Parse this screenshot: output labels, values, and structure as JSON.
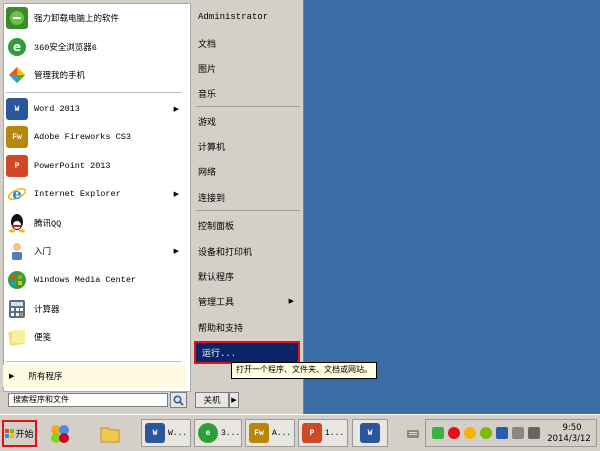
{
  "left_menu": {
    "items": [
      {
        "label": "强力卸载电脑上的软件",
        "icon": "uninstall-icon",
        "color": "#3a8b2c"
      },
      {
        "label": "360安全浏览器6",
        "icon": "360-browser-icon",
        "color": "#2e9e3a"
      },
      {
        "label": "管理我的手机",
        "icon": "phone-manager-icon",
        "color": "#e05a1e"
      },
      {
        "label": "Word 2013",
        "icon": "word-icon",
        "color": "#2b579a",
        "has_submenu": true
      },
      {
        "label": "Adobe Fireworks CS3",
        "icon": "fireworks-icon",
        "color": "#b8860b"
      },
      {
        "label": "PowerPoint 2013",
        "icon": "powerpoint-icon",
        "color": "#d24726"
      },
      {
        "label": "Internet Explorer",
        "icon": "ie-icon",
        "color": "#1e88e5",
        "has_submenu": true
      },
      {
        "label": "腾讯QQ",
        "icon": "qq-icon",
        "color": "#222222"
      },
      {
        "label": "入门",
        "icon": "getting-started-icon",
        "color": "#4a7fbf",
        "has_submenu": true
      },
      {
        "label": "Windows Media Center",
        "icon": "media-center-icon",
        "color": "#3c9a3c"
      },
      {
        "label": "计算器",
        "icon": "calculator-icon",
        "color": "#5a6e8a"
      },
      {
        "label": "便笺",
        "icon": "sticky-notes-icon",
        "color": "#c8c24a"
      }
    ],
    "all_programs": "所有程序",
    "search_placeholder": "搜索程序和文件"
  },
  "right_menu": {
    "items": [
      {
        "label": "Administrator"
      },
      {
        "label": "文档"
      },
      {
        "label": "图片"
      },
      {
        "label": "音乐"
      },
      {
        "label": "游戏"
      },
      {
        "label": "计算机"
      },
      {
        "label": "网络"
      },
      {
        "label": "连接到"
      },
      {
        "label": "控制面板"
      },
      {
        "label": "设备和打印机"
      },
      {
        "label": "默认程序"
      },
      {
        "label": "管理工具",
        "has_submenu": true
      },
      {
        "label": "帮助和支持"
      }
    ],
    "run_label": "运行...",
    "run_tooltip": "打开一个程序、文件夹、文档或网站。",
    "shutdown_label": "关机"
  },
  "taskbar": {
    "start_label": "开始",
    "buttons": [
      {
        "label": "W...",
        "icon": "word-doc-icon",
        "color": "#2b579a"
      },
      {
        "label": "3...",
        "icon": "360-browser-icon",
        "color": "#2e9e3a"
      },
      {
        "label": "A...",
        "icon": "fireworks-icon",
        "color": "#b8860b"
      },
      {
        "label": "1...",
        "icon": "powerpoint-icon",
        "color": "#d24726"
      }
    ],
    "clock_time": "9:50",
    "clock_date": "2014/3/12"
  },
  "colors": {
    "desktop": "#3a6ea5",
    "highlight": "#0a246a",
    "annotation_box": "#e0111b"
  }
}
